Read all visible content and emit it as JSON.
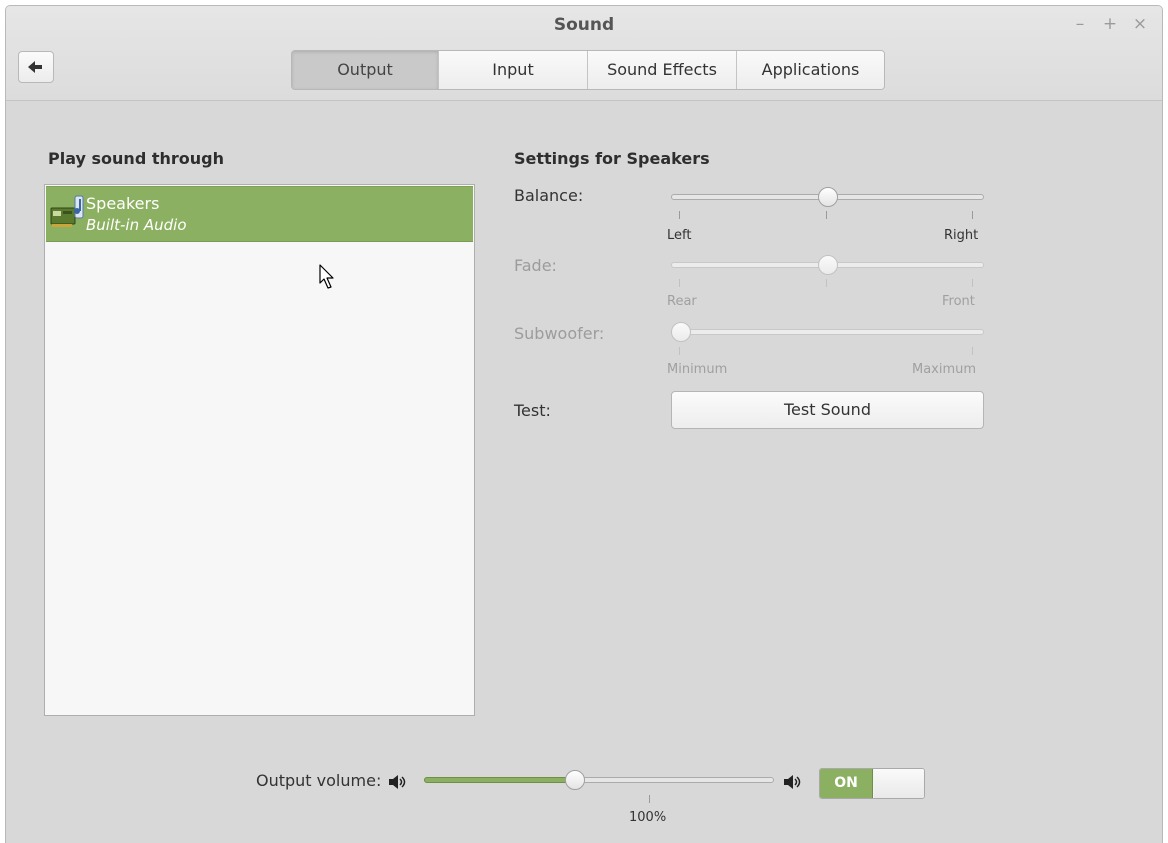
{
  "window": {
    "title": "Sound",
    "controls": {
      "minimize": "–",
      "maximize": "+",
      "close": "×"
    }
  },
  "tabs": [
    {
      "label": "Output",
      "active": true
    },
    {
      "label": "Input",
      "active": false
    },
    {
      "label": "Sound Effects",
      "active": false
    },
    {
      "label": "Applications",
      "active": false
    }
  ],
  "device_list": {
    "heading": "Play sound through",
    "items": [
      {
        "name": "Speakers",
        "description": "Built-in Audio",
        "icon": "sound-card-icon",
        "selected": true
      }
    ]
  },
  "settings": {
    "heading": "Settings for Speakers",
    "balance": {
      "label": "Balance:",
      "left_label": "Left",
      "right_label": "Right",
      "value": 0.5,
      "enabled": true
    },
    "fade": {
      "label": "Fade:",
      "left_label": "Rear",
      "right_label": "Front",
      "value": 0.5,
      "enabled": false
    },
    "subwoofer": {
      "label": "Subwoofer:",
      "left_label": "Minimum",
      "right_label": "Maximum",
      "value": 0.0,
      "enabled": false
    },
    "test": {
      "label": "Test:",
      "button_label": "Test Sound"
    }
  },
  "output_volume": {
    "label": "Output volume:",
    "value_percent": 100,
    "mark_label": "100%",
    "fill_fraction": 0.43,
    "switch_label": "ON",
    "switch_on": true
  },
  "colors": {
    "accent": "#8cb061",
    "window_bg": "#d8d8d8"
  }
}
